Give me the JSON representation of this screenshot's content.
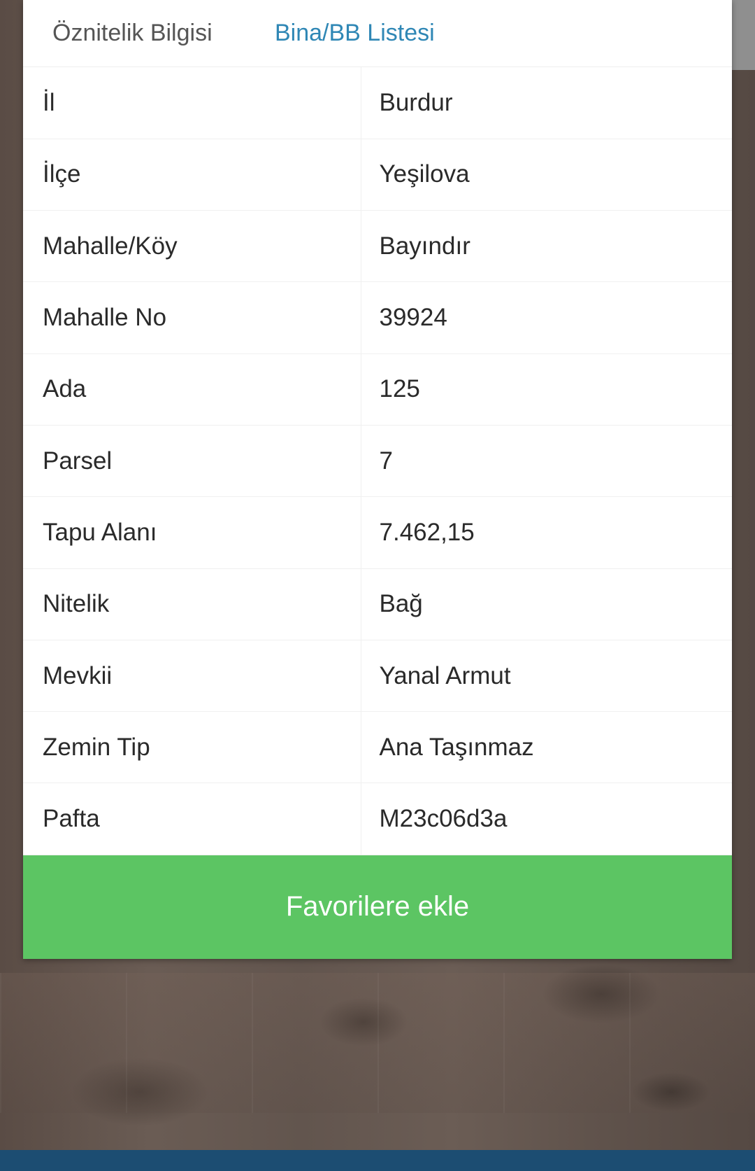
{
  "tabs": [
    {
      "label": "Öznitelik Bilgisi",
      "active": false
    },
    {
      "label": "Bina/BB Listesi",
      "active": true
    }
  ],
  "attributes": [
    {
      "key": "İl",
      "value": "Burdur"
    },
    {
      "key": "İlçe",
      "value": "Yeşilova"
    },
    {
      "key": "Mahalle/Köy",
      "value": "Bayındır"
    },
    {
      "key": "Mahalle No",
      "value": "39924"
    },
    {
      "key": "Ada",
      "value": "125"
    },
    {
      "key": "Parsel",
      "value": "7"
    },
    {
      "key": "Tapu Alanı",
      "value": "7.462,15"
    },
    {
      "key": "Nitelik",
      "value": "Bağ"
    },
    {
      "key": "Mevkii",
      "value": "Yanal Armut"
    },
    {
      "key": "Zemin Tip",
      "value": "Ana Taşınmaz"
    },
    {
      "key": "Pafta",
      "value": "M23c06d3a"
    }
  ],
  "favorite_button": {
    "label": "Favorilere ekle",
    "color": "#5cc563"
  },
  "colors": {
    "active_tab": "#2f87b5",
    "bottom_bar": "#1c4d72"
  }
}
